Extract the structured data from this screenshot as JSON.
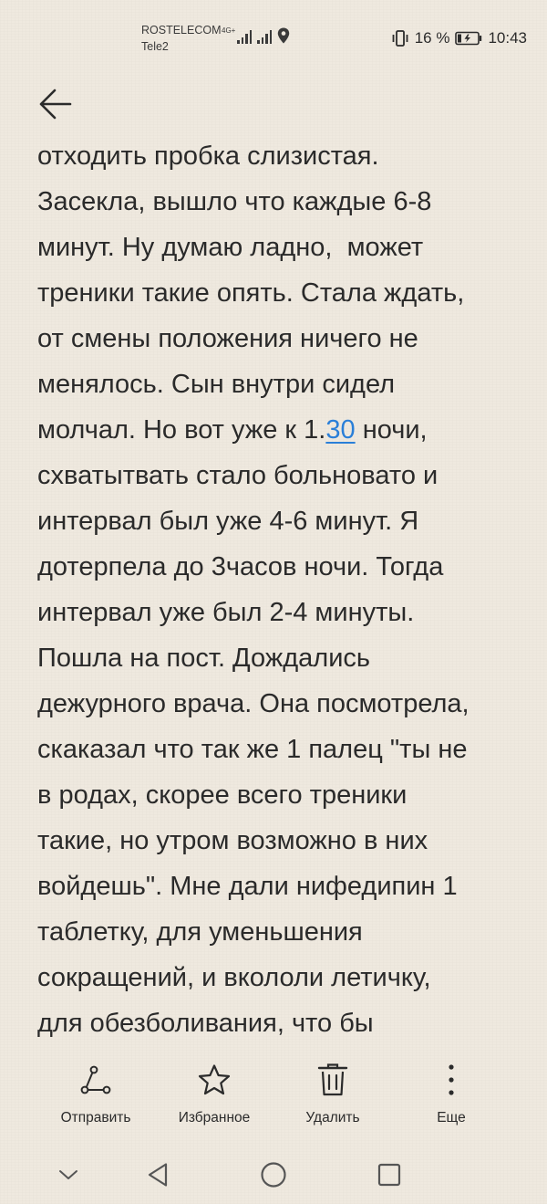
{
  "status_bar": {
    "carrier_1": "ROSTELECOM",
    "carrier_2": "Tele2",
    "network_type": "4G+",
    "battery_percent": "16 %",
    "time": "10:43"
  },
  "header": {
    "back_icon": "arrow-left-icon"
  },
  "note": {
    "lines": [
      "отходить пробка слизистая.",
      "Засекла, вышло что каждые 6-8",
      "минут. Ну думаю ладно,  может",
      "треники такие опять. Стала ждать,",
      "от смены положения ничего не",
      "менялось. Сын внутри сидел"
    ],
    "line_7_before": "молчал. Но вот уже к 1.",
    "line_7_link": "30",
    "line_7_after": " ночи,",
    "lines_after": [
      "схватытвать стало больновато и",
      "интервал был уже 4-6 минут. Я",
      "дотерпела до 3часов ночи. Тогда",
      "интервал уже был 2-4 минуты.",
      "Пошла на пост. Дождались",
      "дежурного врача. Она посмотрела,",
      "скаказал что так же 1 палец \"ты не",
      "в родах, скорее всего треники",
      "такие, но утром возможно в них",
      "войдешь\". Мне дали нифедипин 1",
      "таблетку, для уменьшения",
      "сокращений, и вкололи летичку,",
      "для обезболивания, что бы"
    ]
  },
  "toolbar": {
    "send_label": "Отправить",
    "favorite_label": "Избранное",
    "delete_label": "Удалить",
    "more_label": "Еще"
  },
  "colors": {
    "background": "#efe9df",
    "text": "#2a2a2a",
    "link": "#2a7fd8"
  }
}
